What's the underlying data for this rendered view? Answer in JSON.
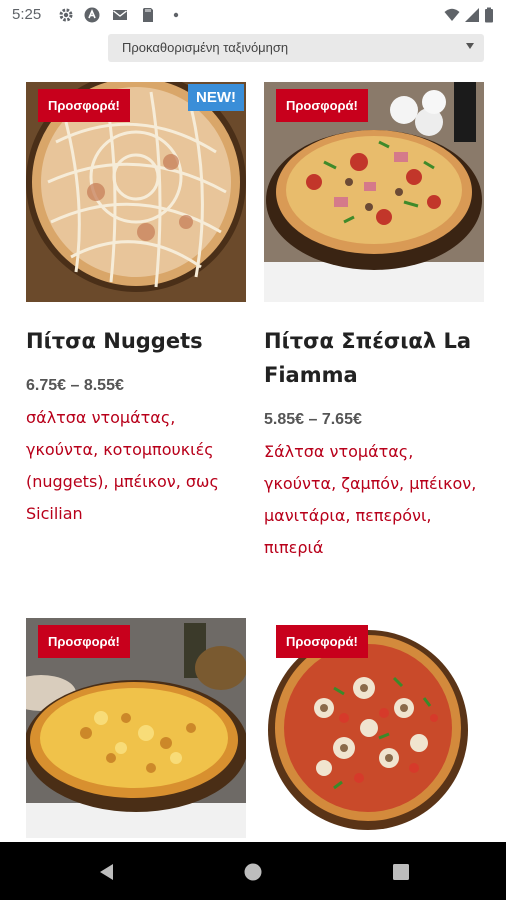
{
  "status_bar": {
    "time": "5:25",
    "left_icons": [
      "gear-icon",
      "circle-a-icon",
      "mail-icon",
      "sd-card-icon",
      "dot-icon"
    ],
    "right_icons": [
      "wifi-icon",
      "signal-icon",
      "battery-icon"
    ]
  },
  "sort": {
    "label": "Προκαθορισμένη ταξινόμηση"
  },
  "products": [
    {
      "badge": "Προσφορά!",
      "new_badge": "NEW!",
      "title": "Πίτσα Nuggets",
      "price": "6.75€ – 8.55€",
      "description": "σάλτσα ντομάτας, γκούντα, κοτομπουκιές (nuggets), μπέικον, σως Sicilian"
    },
    {
      "badge": "Προσφορά!",
      "title": "Πίτσα Σπέσιαλ La Fiamma",
      "price": "5.85€ – 7.65€",
      "description": "Σάλτσα ντομάτας, γκούντα, ζαμπόν, μπέικον, μανιτάρια, πεπερόνι, πιπεριά"
    },
    {
      "badge": "Προσφορά!"
    },
    {
      "badge": "Προσφορά!"
    }
  ],
  "colors": {
    "sale_badge": "#c8001c",
    "new_badge": "#3a8ed8",
    "description": "#b8001a"
  }
}
